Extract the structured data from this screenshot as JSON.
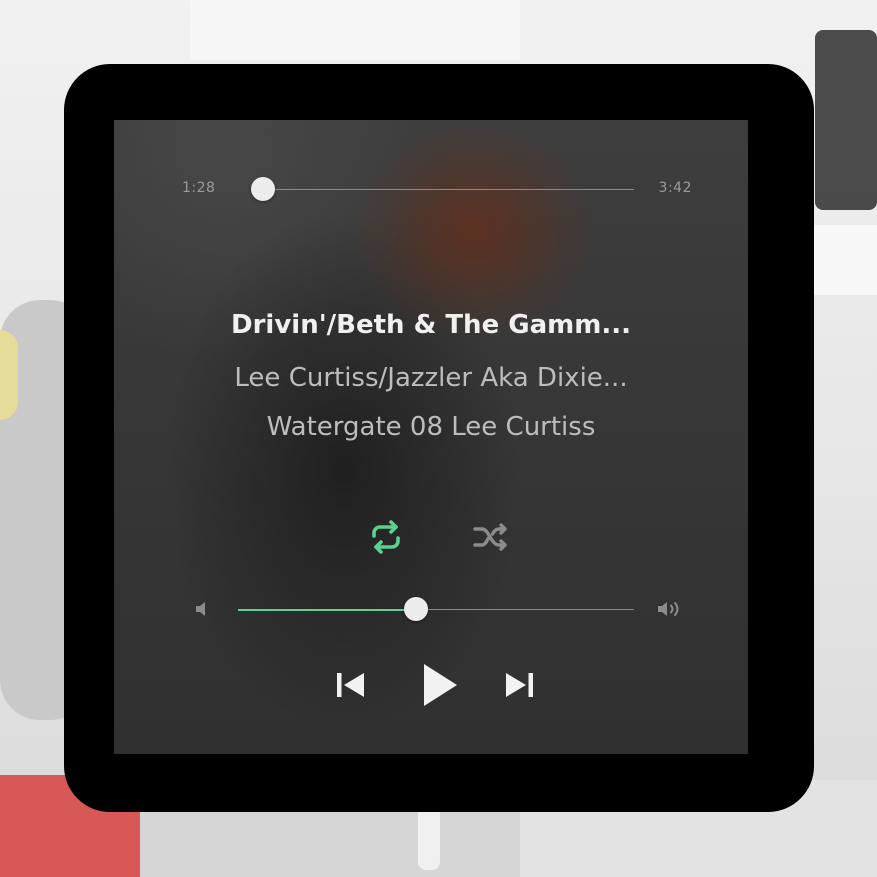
{
  "player": {
    "elapsed": "1:28",
    "total": "3:42",
    "progress_fraction": 0.03,
    "track_title": "Drivin'/Beth & The Gamm...",
    "artist": "Lee Curtiss/Jazzler Aka Dixie...",
    "album": "Watergate 08 Lee Curtiss",
    "repeat_active": true,
    "shuffle_active": false,
    "volume_fraction": 0.45,
    "icons": {
      "repeat": "repeat-icon",
      "shuffle": "shuffle-icon",
      "volume_low": "volume-low-icon",
      "volume_high": "volume-high-icon",
      "previous": "skip-previous-icon",
      "play": "play-icon",
      "next": "skip-next-icon"
    }
  },
  "colors": {
    "accent": "#5bd18f",
    "inactive_icon": "#8c8c8c",
    "control_icon": "#f2f2f2",
    "bezel": "#000000"
  }
}
